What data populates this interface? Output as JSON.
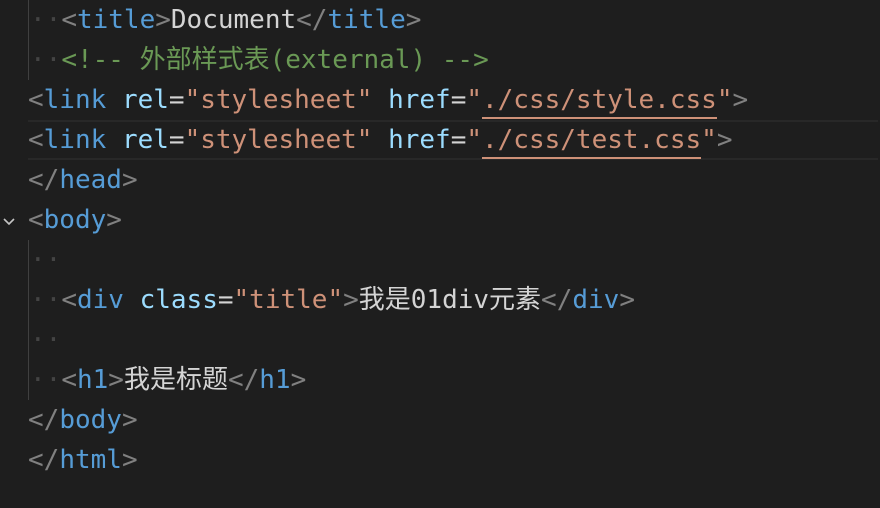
{
  "code": {
    "line1": {
      "open": "<",
      "tag": "title",
      "close": ">",
      "text": "Document",
      "end_open": "</",
      "end_tag": "title",
      "end_close": ">"
    },
    "line2": {
      "comment": "<!-- 外部样式表(external) -->"
    },
    "line3": {
      "open": "<",
      "tag": "link",
      "attr1": "rel",
      "eq1": "=",
      "val1": "\"stylesheet\"",
      "attr2": "href",
      "eq2": "=",
      "q1": "\"",
      "href": "./css/style.css",
      "q2": "\"",
      "close": ">"
    },
    "line4": {
      "open": "<",
      "tag": "link",
      "attr1": "rel",
      "eq1": "=",
      "val1": "\"stylesheet\"",
      "attr2": "href",
      "eq2": "=",
      "q1": "\"",
      "href": "./css/test.css",
      "q2": "\"",
      "close": ">"
    },
    "line5": {
      "open": "</",
      "tag": "head",
      "close": ">"
    },
    "line6": {
      "open": "<",
      "tag": "body",
      "close": ">"
    },
    "line8": {
      "open": "<",
      "tag": "div",
      "attr": "class",
      "eq": "=",
      "val": "\"title\"",
      "close": ">",
      "text": "我是01div元素",
      "end_open": "</",
      "end_tag": "div",
      "end_close": ">"
    },
    "line10": {
      "open": "<",
      "tag": "h1",
      "close": ">",
      "text": "我是标题",
      "end_open": "</",
      "end_tag": "h1",
      "end_close": ">"
    },
    "line11": {
      "open": "</",
      "tag": "body",
      "close": ">"
    },
    "line12": {
      "open": "</",
      "tag": "html",
      "close": ">"
    }
  },
  "whitespace_marker": "··",
  "fold_icon": "chevron-down-icon",
  "colors": {
    "background": "#1e1e1e",
    "tag": "#569cd6",
    "attribute": "#9cdcfe",
    "string": "#ce9178",
    "comment": "#6a9955",
    "bracket": "#808080",
    "text": "#d4d4d4"
  }
}
